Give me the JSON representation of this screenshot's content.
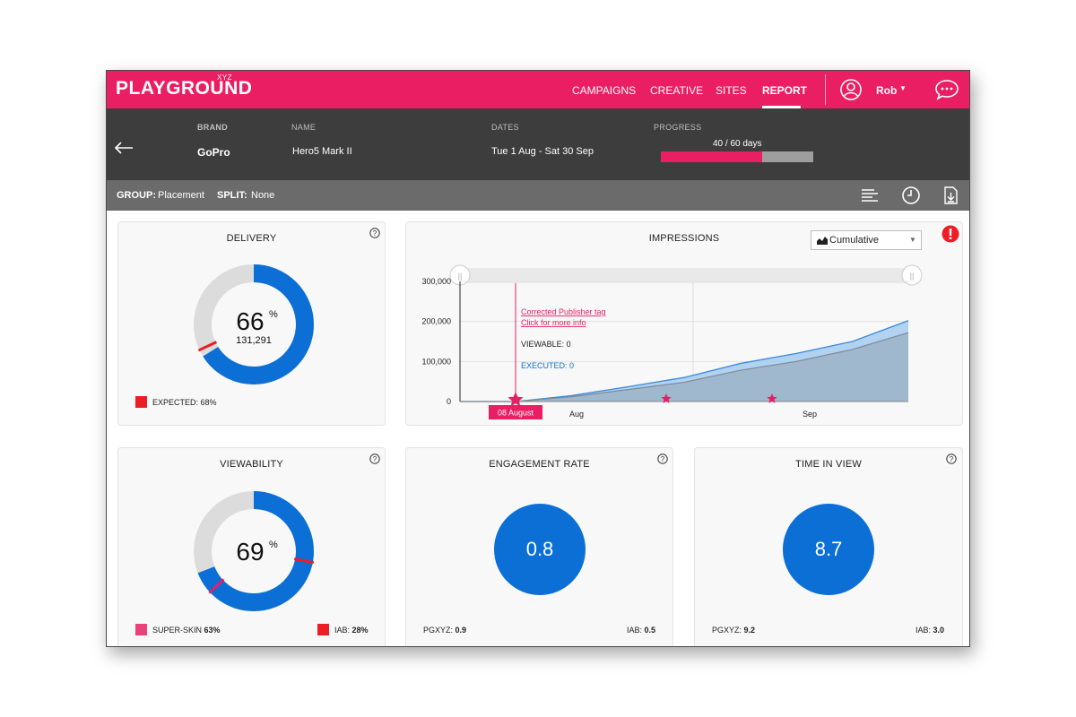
{
  "app": {
    "logo": "PLAYGROUND",
    "logo_suffix": "XYZ"
  },
  "nav": {
    "items": [
      "CAMPAIGNS",
      "CREATIVE",
      "SITES",
      "REPORT"
    ],
    "active": "REPORT",
    "user": "Rob",
    "icons": [
      "user-icon",
      "chevron-down-icon",
      "chat-icon"
    ]
  },
  "info": {
    "brand_label": "BRAND",
    "brand": "GoPro",
    "name_label": "NAME",
    "name": "Hero5 Mark II",
    "dates_label": "DATES",
    "dates": "Tue 1 Aug - Sat 30 Sep",
    "progress_label": "PROGRESS",
    "progress_text": "40 / 60 days",
    "progress_fraction": 0.667
  },
  "group": {
    "group_label": "GROUP:",
    "group_value": "Placement",
    "split_label": "SPLIT:",
    "split_value": "None",
    "tools": [
      "list-icon",
      "clock-icon",
      "download-icon"
    ]
  },
  "delivery": {
    "title": "DELIVERY",
    "percent": "66",
    "percent_sign": "%",
    "count": "131,291",
    "value_fraction": 0.66,
    "expected_fraction": 0.68,
    "legend": "EXPECTED: 68%",
    "colors": {
      "fill": "#0b6fd6",
      "track": "#dcdcdc",
      "marker": "#ee1c25"
    }
  },
  "impressions": {
    "title": "IMPRESSIONS",
    "mode": "Cumulative",
    "annotation_line1": "Corrected Publisher tag",
    "annotation_line2": "Click for more info",
    "viewable": "VIEWABLE: 0",
    "executed": "EXECUTED: 0",
    "date_tag": "08 August"
  },
  "chart_data": {
    "type": "area",
    "x": [
      "Aug 1",
      "Aug 8",
      "Aug 15",
      "Aug 22",
      "Aug 29",
      "Sep 5",
      "Sep 12",
      "Sep 19",
      "Sep 30"
    ],
    "series": [
      {
        "name": "EXECUTED",
        "values": [
          0,
          0,
          15000,
          37000,
          60000,
          95000,
          120000,
          150000,
          202000
        ]
      },
      {
        "name": "VIEWABLE",
        "values": [
          0,
          0,
          12000,
          30000,
          48000,
          78000,
          100000,
          130000,
          172000
        ]
      }
    ],
    "ylim": [
      0,
      300000
    ],
    "yticks": [
      "0",
      "100,000",
      "200,000",
      "300,000"
    ],
    "xticks": [
      "Aug",
      "Sep"
    ],
    "event_markers": [
      "Aug 8",
      "Aug 22",
      "Sep 9"
    ],
    "colors": {
      "executed": "#a9cdf0",
      "viewable": "#9db4c8",
      "marker": "#e91e63"
    }
  },
  "viewability": {
    "title": "VIEWABILITY",
    "percent": "69",
    "percent_sign": "%",
    "value_fraction": 0.69,
    "legend1_label": "SUPER-SKIN",
    "legend1_value": "63%",
    "legend2_label": "IAB:",
    "legend2_value": "28%"
  },
  "engagement": {
    "title": "ENGAGEMENT RATE",
    "value": "0.8",
    "left_label": "PGXYZ:",
    "left_value": "0.9",
    "right_label": "IAB:",
    "right_value": "0.5"
  },
  "timeinview": {
    "title": "TIME IN VIEW",
    "value": "8.7",
    "left_label": "PGXYZ:",
    "left_value": "9.2",
    "right_label": "IAB:",
    "right_value": "3.0"
  }
}
